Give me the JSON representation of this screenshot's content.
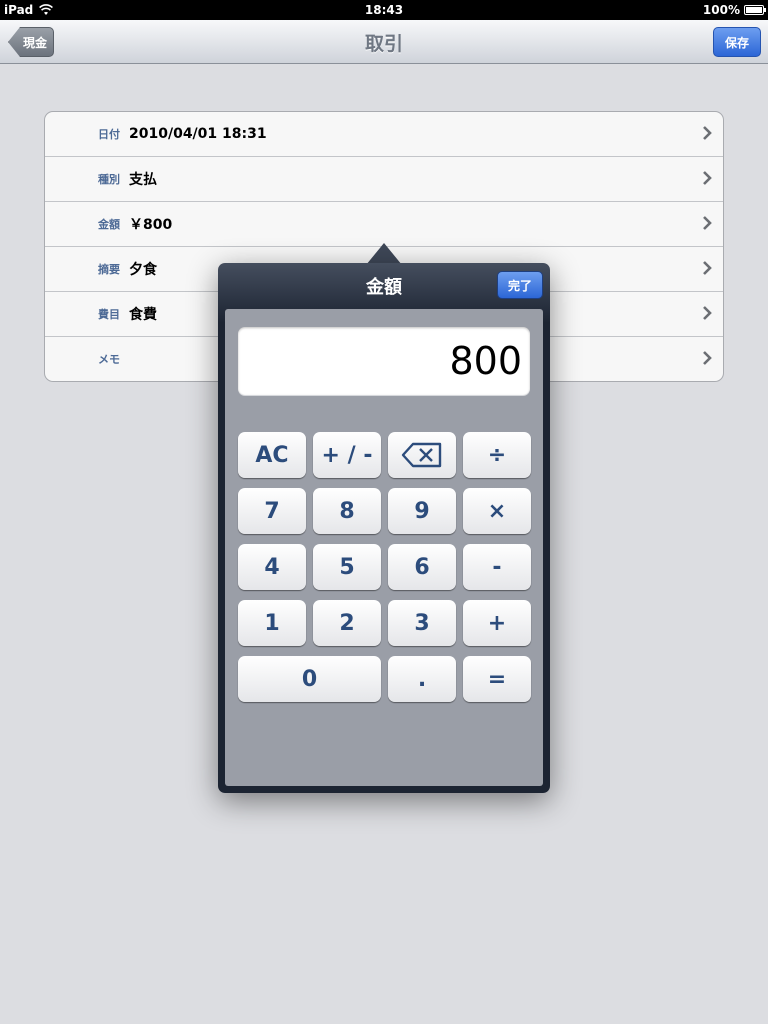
{
  "status": {
    "device": "iPad",
    "time": "18:43",
    "battery": "100%"
  },
  "nav": {
    "title": "取引",
    "back_label": "現金",
    "save_label": "保存"
  },
  "rows": [
    {
      "label": "日付",
      "value": "2010/04/01 18:31"
    },
    {
      "label": "種別",
      "value": "支払"
    },
    {
      "label": "金額",
      "value": "￥800"
    },
    {
      "label": "摘要",
      "value": "夕食"
    },
    {
      "label": "費目",
      "value": "食費"
    },
    {
      "label": "メモ",
      "value": ""
    }
  ],
  "popover": {
    "title": "金額",
    "done_label": "完了",
    "display_value": "800",
    "keys": {
      "ac": "AC",
      "sign": "+ / -",
      "backspace": "⌫",
      "divide": "÷",
      "k7": "7",
      "k8": "8",
      "k9": "9",
      "multiply": "×",
      "k4": "4",
      "k5": "5",
      "k6": "6",
      "minus": "-",
      "k1": "1",
      "k2": "2",
      "k3": "3",
      "plus": "+",
      "k0": "0",
      "dot": ".",
      "equals": "="
    }
  },
  "colors": {
    "accent_blue": "#2c66d6",
    "label_blue": "#4d6a96",
    "key_text": "#2c4c7c"
  }
}
